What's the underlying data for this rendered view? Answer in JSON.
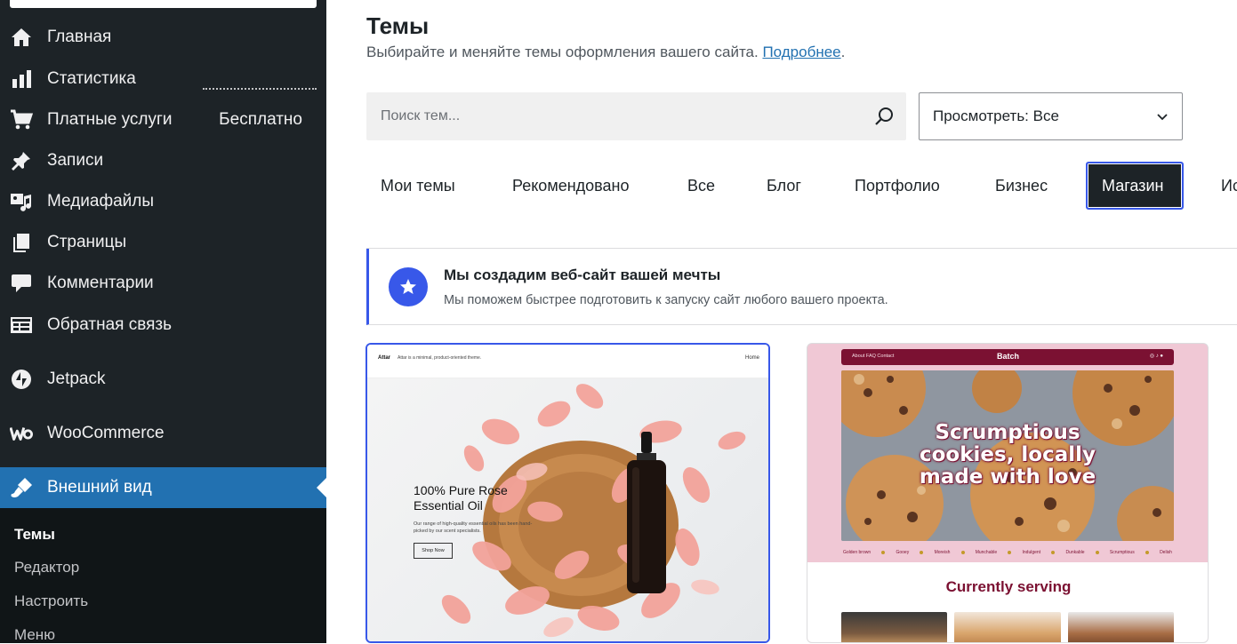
{
  "sidebar": {
    "items": [
      {
        "label": "Главная",
        "icon": "home-icon"
      },
      {
        "label": "Статистика",
        "icon": "stats-icon"
      },
      {
        "label": "Платные услуги",
        "icon": "cart-icon",
        "badge": "Бесплатно"
      },
      {
        "label": "Записи",
        "icon": "pin-icon"
      },
      {
        "label": "Медиафайлы",
        "icon": "media-icon"
      },
      {
        "label": "Страницы",
        "icon": "pages-icon"
      },
      {
        "label": "Комментарии",
        "icon": "comment-icon"
      },
      {
        "label": "Обратная связь",
        "icon": "feedback-icon"
      },
      {
        "label": "Jetpack",
        "icon": "jetpack-icon"
      },
      {
        "label": "WooCommerce",
        "icon": "woocommerce-icon"
      },
      {
        "label": "Внешний вид",
        "icon": "appearance-icon",
        "active": true
      }
    ],
    "submenu": [
      {
        "label": "Темы",
        "current": true
      },
      {
        "label": "Редактор"
      },
      {
        "label": "Настроить"
      },
      {
        "label": "Меню"
      }
    ],
    "accent": "#2271b1"
  },
  "header": {
    "title": "Темы",
    "description": "Выбирайте и меняйте темы оформления вашего сайта.",
    "link_text": "Подробнее"
  },
  "search": {
    "placeholder": "Поиск тем..."
  },
  "view_filter": {
    "label": "Просмотреть: Все"
  },
  "tabs": [
    {
      "label": "Мои темы"
    },
    {
      "label": "Рекомендовано"
    },
    {
      "label": "Все"
    },
    {
      "label": "Блог"
    },
    {
      "label": "Портфолио"
    },
    {
      "label": "Бизнес"
    },
    {
      "label": "Магазин",
      "active": true
    },
    {
      "label": "Ис"
    }
  ],
  "notice": {
    "title": "Мы создадим веб-сайт вашей мечты",
    "text": "Мы поможем быстрее подготовить к запуску сайт любого вашего проекта.",
    "accent": "#3858e9"
  },
  "themes": [
    {
      "brand": "Attar",
      "tagline": "Attar is a minimal, product-oriented theme.",
      "nav": "Home",
      "hero_title_line1": "100% Pure Rose",
      "hero_title_line2": "Essential Oil",
      "hero_text": "Our range of high-quality essential oils has been hand-picked by our scent specialists.",
      "button": "Shop Now"
    },
    {
      "nav_links": "About   FAQ   Contact",
      "brand": "Batch",
      "hero_line1": "Scrumptious",
      "hero_line2": "cookies, locally",
      "hero_line3": "made with love",
      "strip": [
        "Golden brown",
        "Gooey",
        "Moreish",
        "Munchable",
        "Indulgent",
        "Dunkable",
        "Scrumptious",
        "Delish"
      ],
      "section_title": "Currently serving",
      "accent": "#7b1132"
    }
  ]
}
